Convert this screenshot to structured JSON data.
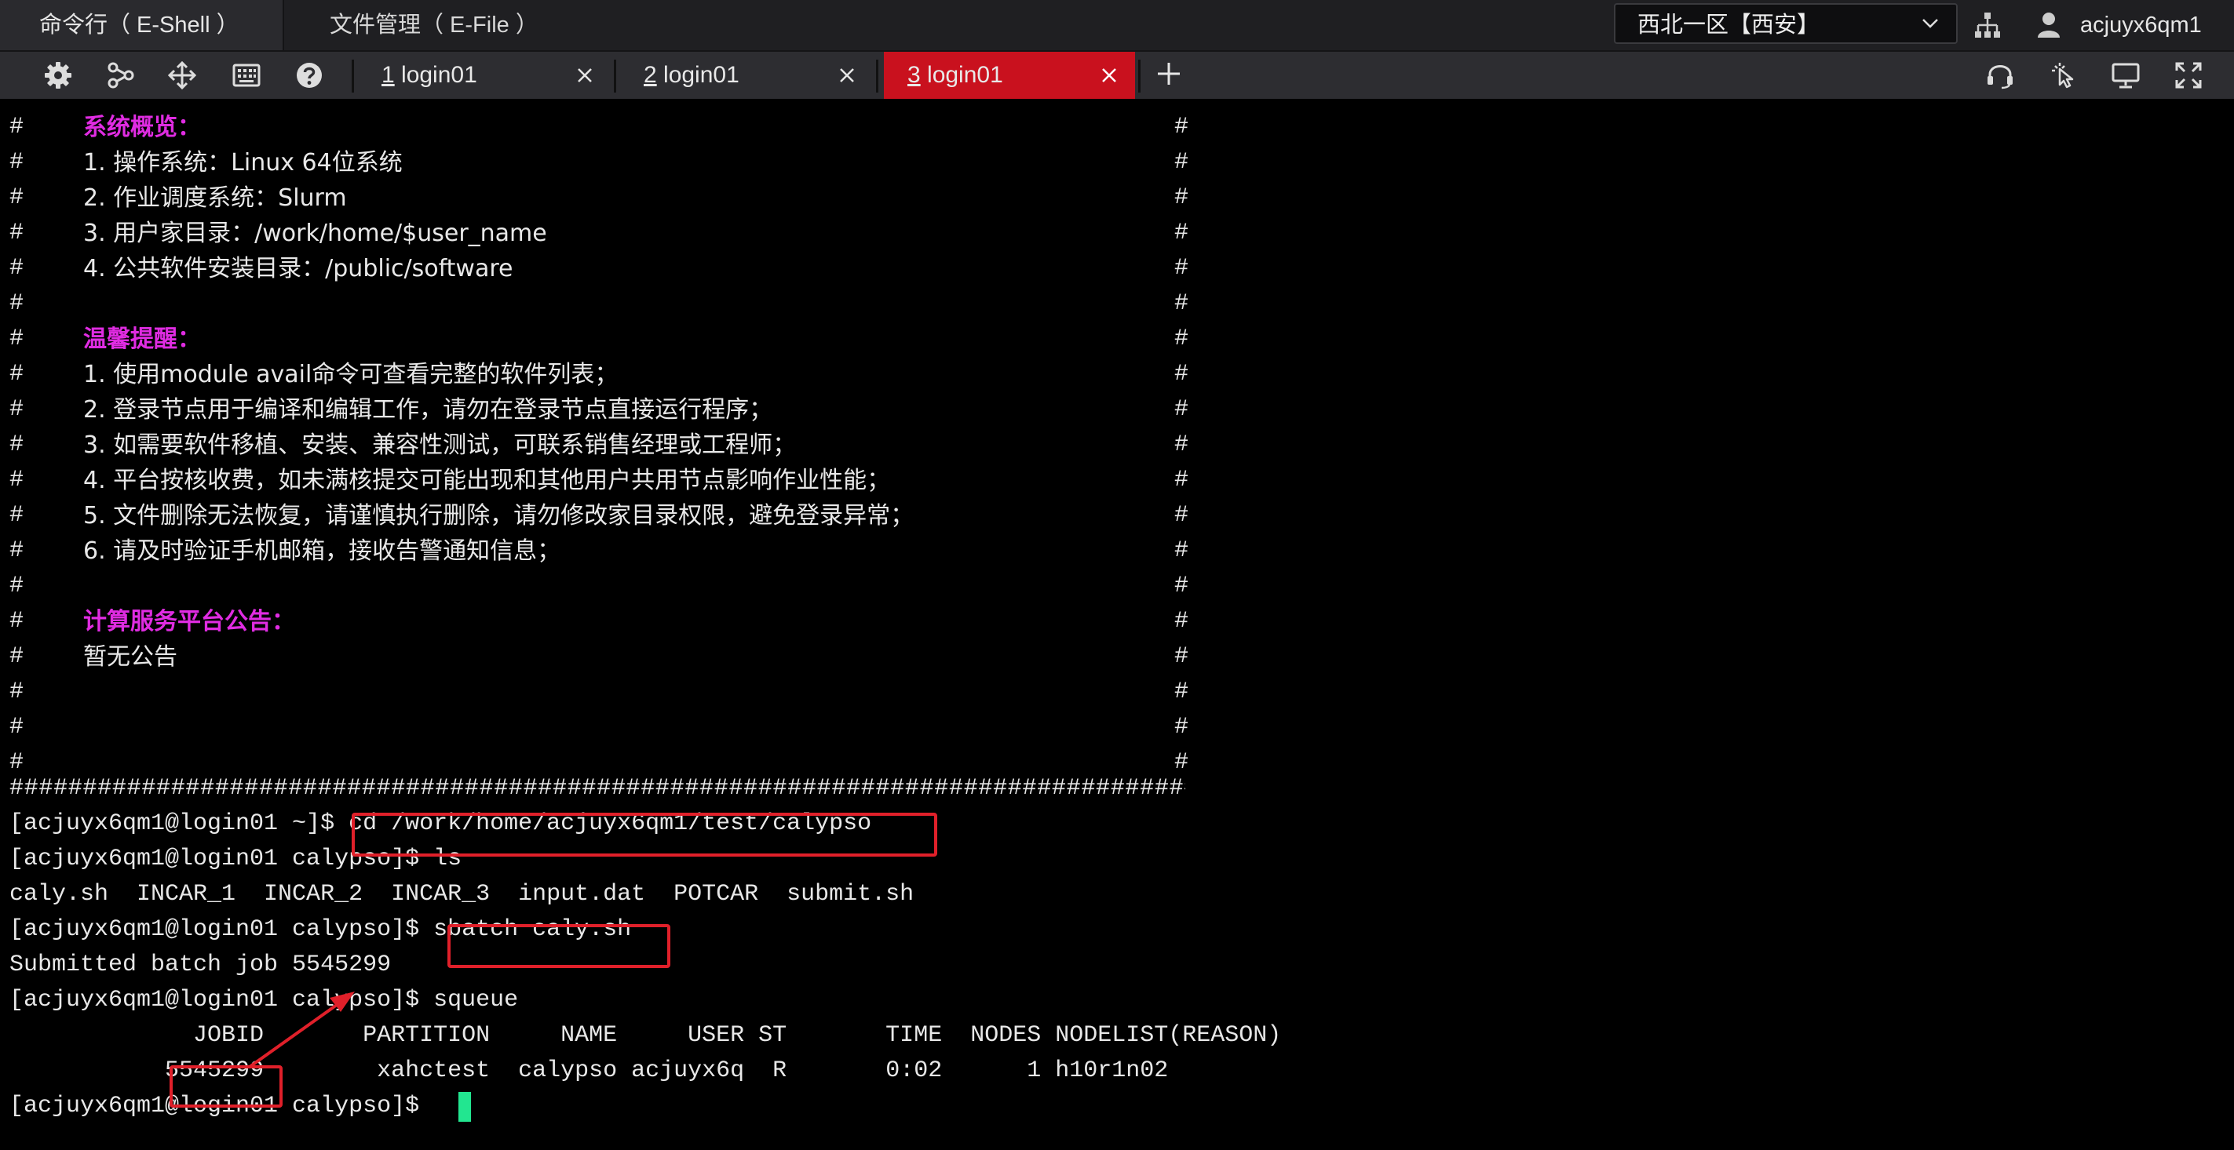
{
  "top": {
    "app_tabs": [
      {
        "label": "命令行（ E-Shell ）",
        "active": true
      },
      {
        "label": "文件管理（ E-File ）",
        "active": false
      }
    ],
    "region": "西北一区【西安】",
    "username": "acjuyx6qm1"
  },
  "tabbar": {
    "tabs": [
      {
        "num": "1",
        "label": " login01",
        "active": false
      },
      {
        "num": "2",
        "label": " login01",
        "active": false
      },
      {
        "num": "3",
        "label": " login01",
        "active": true
      }
    ],
    "icons": [
      "settings-icon",
      "share-node-icon",
      "transfer-icon",
      "keyboard-icon",
      "help-icon"
    ],
    "right_icons": [
      "headset-icon",
      "pointer-icon",
      "monitor-icon",
      "fullscreen-icon"
    ]
  },
  "terminal": {
    "banner": [
      {
        "text": "系统概览：",
        "highlight": true
      },
      {
        "text": "1. 操作系统：Linux 64位系统"
      },
      {
        "text": "2. 作业调度系统：Slurm"
      },
      {
        "text": "3. 用户家目录：/work/home/$user_name"
      },
      {
        "text": "4. 公共软件安装目录：/public/software"
      },
      {
        "text": ""
      },
      {
        "text": "温馨提醒：",
        "highlight": true
      },
      {
        "text": "1. 使用module avail命令可查看完整的软件列表；"
      },
      {
        "text": "2. 登录节点用于编译和编辑工作，请勿在登录节点直接运行程序；"
      },
      {
        "text": "3. 如需要软件移植、安装、兼容性测试，可联系销售经理或工程师；"
      },
      {
        "text": "4. 平台按核收费，如未满核提交可能出现和其他用户共用节点影响作业性能；"
      },
      {
        "text": "5. 文件删除无法恢复，请谨慎执行删除，请勿修改家目录权限，避免登录异常；"
      },
      {
        "text": "6. 请及时验证手机邮箱，接收告警通知信息；"
      },
      {
        "text": ""
      },
      {
        "text": "计算服务平台公告：",
        "highlight": true
      },
      {
        "text": "暂无公告"
      },
      {
        "text": ""
      },
      {
        "text": ""
      },
      {
        "text": ""
      }
    ],
    "hash": "#",
    "rule": "##############################################################################################################################",
    "prompt_home": "[acjuyx6qm1@login01 ~]$ ",
    "prompt_calypso": "[acjuyx6qm1@login01 calypso]$ ",
    "cmd_cd": "cd /work/home/acjuyx6qm1/test/calypso",
    "cmd_ls": "ls",
    "ls_output": "caly.sh  INCAR_1  INCAR_2  INCAR_3  input.dat  POTCAR  submit.sh",
    "cmd_sbatch": "sbatch caly.sh",
    "sbatch_output": "Submitted batch job 5545299",
    "cmd_squeue": "squeue",
    "squeue_header": "             JOBID       PARTITION     NAME     USER ST       TIME  NODES NODELIST(REASON)",
    "squeue_row_pre": "           ",
    "squeue_jobid": "5545299",
    "squeue_row_rest": "        xahctest  calypso acjuyx6q  R       0:02      1 h10r1n02"
  }
}
